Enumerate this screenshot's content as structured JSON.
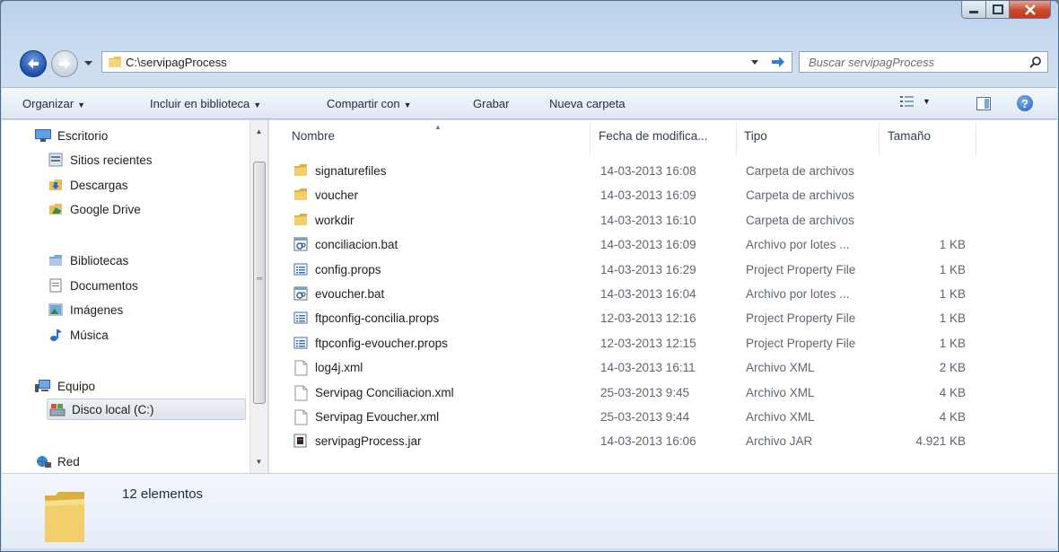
{
  "titlebar": {
    "min_label": "",
    "max_label": "",
    "close_label": ""
  },
  "address": {
    "path": "C:\\servipagProcess"
  },
  "search": {
    "placeholder": "Buscar servipagProcess"
  },
  "commands": {
    "organize": "Organizar",
    "include_library": "Incluir en biblioteca",
    "share_with": "Compartir con",
    "burn": "Grabar",
    "new_folder": "Nueva carpeta"
  },
  "nav": {
    "items": [
      {
        "label": "Escritorio",
        "icon": "desktop-icon"
      },
      {
        "label": "Sitios recientes",
        "icon": "recent-places-icon"
      },
      {
        "label": "Descargas",
        "icon": "downloads-icon"
      },
      {
        "label": "Google Drive",
        "icon": "google-drive-icon"
      },
      {
        "label": "Bibliotecas",
        "icon": "libraries-icon"
      },
      {
        "label": "Documentos",
        "icon": "documents-icon"
      },
      {
        "label": "Imágenes",
        "icon": "pictures-icon"
      },
      {
        "label": "Música",
        "icon": "music-icon"
      },
      {
        "label": "Equipo",
        "icon": "computer-icon"
      },
      {
        "label": "Disco local (C:)",
        "icon": "local-disk-icon",
        "selected": true
      },
      {
        "label": "Red",
        "icon": "network-icon"
      }
    ]
  },
  "columns": {
    "name": "Nombre",
    "date": "Fecha de modifica...",
    "type": "Tipo",
    "size": "Tamaño"
  },
  "files": [
    {
      "name": "signaturefiles",
      "date": "14-03-2013 16:08",
      "type": "Carpeta de archivos",
      "size": "",
      "icon": "folder"
    },
    {
      "name": "voucher",
      "date": "14-03-2013 16:09",
      "type": "Carpeta de archivos",
      "size": "",
      "icon": "folder"
    },
    {
      "name": "workdir",
      "date": "14-03-2013 16:10",
      "type": "Carpeta de archivos",
      "size": "",
      "icon": "folder"
    },
    {
      "name": "conciliacion.bat",
      "date": "14-03-2013 16:09",
      "type": "Archivo por lotes ...",
      "size": "1 KB",
      "icon": "bat"
    },
    {
      "name": "config.props",
      "date": "14-03-2013 16:29",
      "type": "Project Property File",
      "size": "1 KB",
      "icon": "props"
    },
    {
      "name": "evoucher.bat",
      "date": "14-03-2013 16:04",
      "type": "Archivo por lotes ...",
      "size": "1 KB",
      "icon": "bat"
    },
    {
      "name": "ftpconfig-concilia.props",
      "date": "12-03-2013 12:16",
      "type": "Project Property File",
      "size": "1 KB",
      "icon": "props"
    },
    {
      "name": "ftpconfig-evoucher.props",
      "date": "12-03-2013 12:15",
      "type": "Project Property File",
      "size": "1 KB",
      "icon": "props"
    },
    {
      "name": "log4j.xml",
      "date": "14-03-2013 16:11",
      "type": "Archivo XML",
      "size": "2 KB",
      "icon": "xml"
    },
    {
      "name": "Servipag Conciliacion.xml",
      "date": "25-03-2013 9:45",
      "type": "Archivo XML",
      "size": "4 KB",
      "icon": "xml"
    },
    {
      "name": "Servipag Evoucher.xml",
      "date": "25-03-2013 9:44",
      "type": "Archivo XML",
      "size": "4 KB",
      "icon": "xml"
    },
    {
      "name": "servipagProcess.jar",
      "date": "14-03-2013 16:06",
      "type": "Archivo JAR",
      "size": "4.921 KB",
      "icon": "jar"
    }
  ],
  "status": {
    "item_count": "12 elementos"
  }
}
